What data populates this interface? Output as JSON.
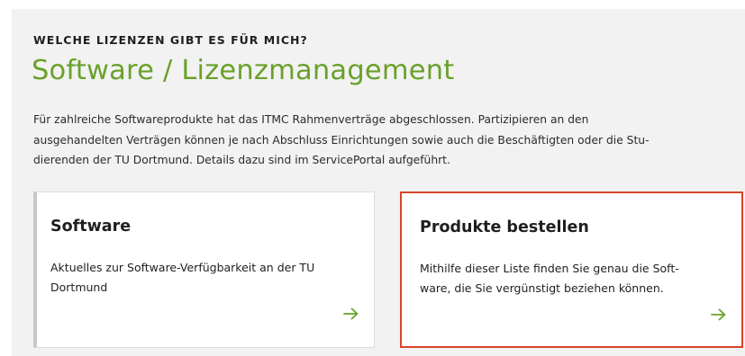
{
  "section": {
    "eyebrow": "WELCHE LIZENZEN GIBT ES FÜR MICH?",
    "title": "Software / Lizenzmanagement",
    "intro_lines": [
      "Für zahlreiche Softwareprodukte hat das ITMC Rahmenverträge abgeschlossen. Partizipieren an den",
      "ausgehandelten Verträgen können je nach Abschluss Einrichtungen sowie auch die Beschäftigten oder die Stu-",
      "dierenden der TU Dortmund. Details dazu sind im ServicePortal aufgeführt."
    ]
  },
  "cards": [
    {
      "title": "Software",
      "text_lines": [
        "Aktuelles zur Software-Verfügbarkeit an der TU",
        "Dortmund"
      ],
      "icon": "arrow-right-icon"
    },
    {
      "title": "Produkte bestellen",
      "text_lines": [
        "Mithilfe dieser Liste finden Sie genau die Soft-",
        "ware, die Sie vergünstigt beziehen können."
      ],
      "icon": "arrow-right-icon"
    }
  ],
  "colors": {
    "title_green": "#6aa12a",
    "arrow_green": "#6aa12a",
    "highlight_border": "#d9432b",
    "panel_background": "#f2f2f2"
  }
}
